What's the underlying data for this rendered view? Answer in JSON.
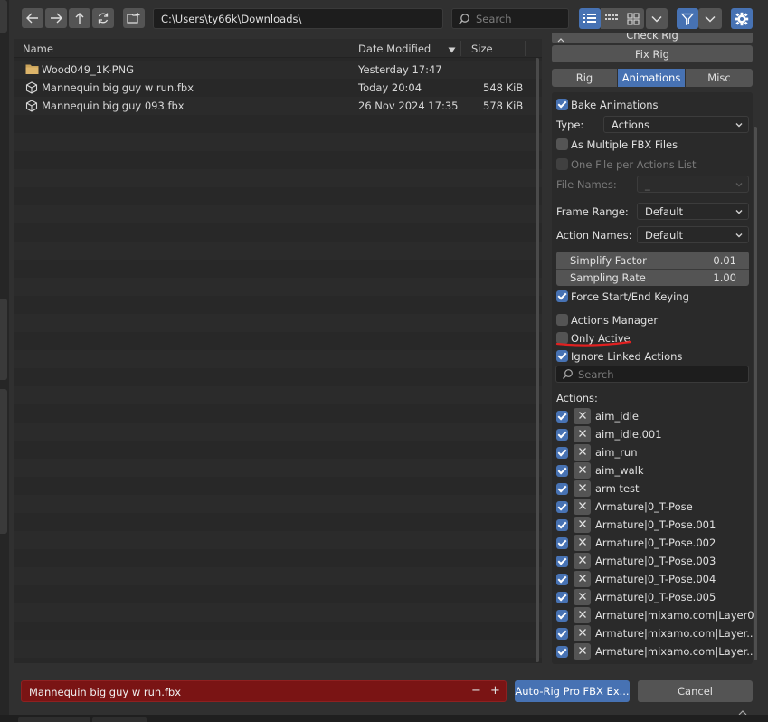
{
  "toolbar": {
    "path": "C:\\Users\\ty66k\\Downloads\\",
    "search_placeholder": "Search"
  },
  "file_list": {
    "columns": {
      "name": "Name",
      "date": "Date Modified",
      "size": "Size"
    },
    "rows": [
      {
        "name": "Wood049_1K-PNG",
        "date": "Yesterday 17:47",
        "size": "",
        "kind": "folder-icon"
      },
      {
        "name": "Mannequin big guy w run.fbx",
        "date": "Today 20:04",
        "size": "548 KiB",
        "kind": "mesh-icon"
      },
      {
        "name": "Mannequin big guy 093.fbx",
        "date": "26 Nov 2024 17:35",
        "size": "578 KiB",
        "kind": "mesh-icon"
      }
    ]
  },
  "panel": {
    "check_rig_label": "Check Rig",
    "fix_rig_label": "Fix Rig",
    "tabs": [
      "Rig",
      "Animations",
      "Misc"
    ],
    "active_tab": "Animations",
    "bake_animations": "Bake Animations",
    "type_label": "Type:",
    "type_value": "Actions",
    "multiple_fbx": "As Multiple FBX Files",
    "one_file_per_action": "One File per Actions List",
    "file_names_label": "File Names:",
    "file_names_value": "_",
    "frame_range_label": "Frame Range:",
    "frame_range_value": "Default",
    "action_names_label": "Action Names:",
    "action_names_value": "Default",
    "simplify_factor_label": "Simplify Factor",
    "simplify_factor_value": "0.01",
    "sampling_rate_label": "Sampling Rate",
    "sampling_rate_value": "1.00",
    "force_keying": "Force Start/End Keying",
    "actions_manager": "Actions Manager",
    "only_active": "Only Active",
    "ignore_linked": "Ignore Linked Actions",
    "search_placeholder": "Search",
    "actions_label": "Actions:",
    "actions": [
      "aim_idle",
      "aim_idle.001",
      "aim_run",
      "aim_walk",
      "arm test",
      "Armature|0_T-Pose",
      "Armature|0_T-Pose.001",
      "Armature|0_T-Pose.002",
      "Armature|0_T-Pose.003",
      "Armature|0_T-Pose.004",
      "Armature|0_T-Pose.005",
      "Armature|mixamo.com|Layer0",
      "Armature|mixamo.com|Layer...",
      "Armature|mixamo.com|Layer..."
    ]
  },
  "footer": {
    "filename": "Mannequin big guy w run.fbx",
    "minus": "−",
    "plus": "+",
    "export_label": "Auto-Rig Pro FBX Ex...",
    "cancel_label": "Cancel"
  },
  "colors": {
    "accent": "#4772b3",
    "filename_bg": "#7a1414",
    "annotation": "#e02020"
  }
}
